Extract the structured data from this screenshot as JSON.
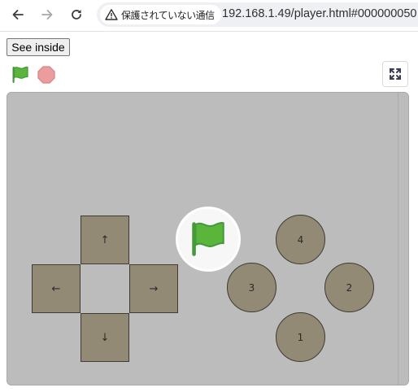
{
  "browser": {
    "security_label": "保護されていない通信",
    "url": "192.168.1.49/player.html#000000050",
    "icons": {
      "back": "arrow-left-icon",
      "forward": "arrow-right-icon",
      "reload": "reload-icon",
      "security": "warning-triangle-icon"
    }
  },
  "player": {
    "see_inside_label": "See inside",
    "controls": {
      "green_flag_icon": "green-flag-icon",
      "stop_icon": "stop-sign-icon",
      "fullscreen_icon": "fullscreen-icon"
    }
  },
  "stage": {
    "dpad": {
      "up": "↑",
      "down": "↓",
      "left": "←",
      "right": "→"
    },
    "buttons": {
      "top": "4",
      "left": "3",
      "right": "2",
      "bottom": "1"
    },
    "overlay_icon": "green-flag-icon"
  },
  "colors": {
    "stage_background": "#bcbcbc",
    "key_fill": "#928a74",
    "key_border": "#3f3b33",
    "flag_green": "#5cb53b",
    "stop_red": "#ec9c9c",
    "omnibox": "#eef0f4"
  }
}
